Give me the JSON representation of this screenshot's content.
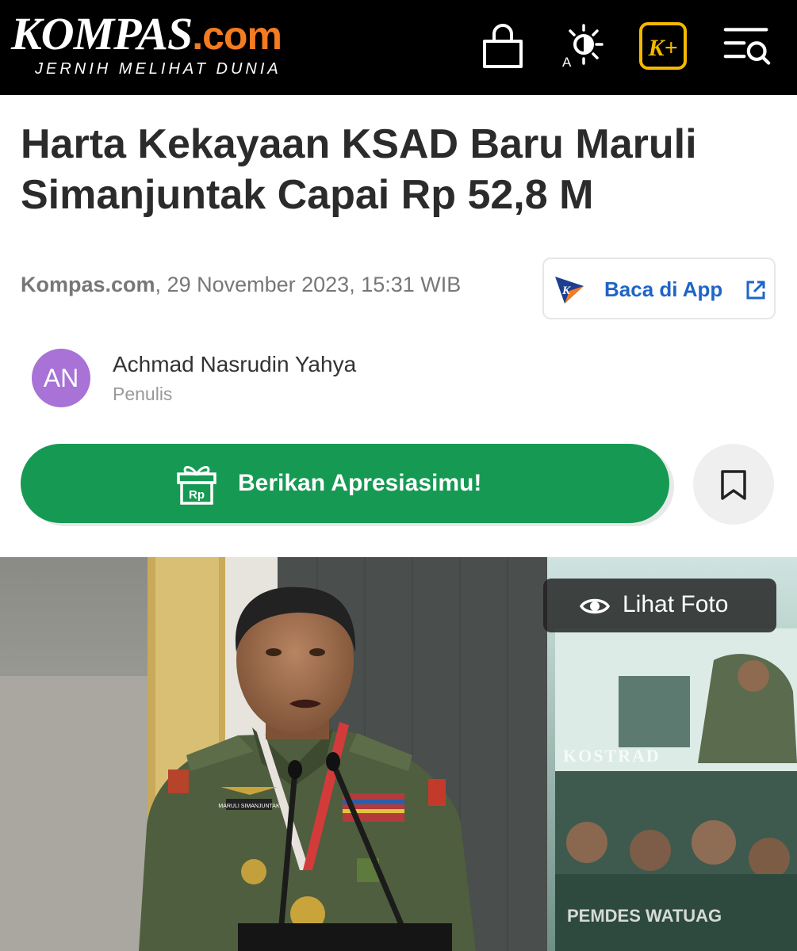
{
  "header": {
    "logo_main": "KOMPAS",
    "logo_dotcom": ".com",
    "logo_tagline": "JERNIH MELIHAT DUNIA",
    "icons": [
      "shopping-bag-icon",
      "theme-brightness-icon",
      "kompas-plus-icon",
      "menu-search-icon"
    ],
    "brightness_letter": "A",
    "kplus_label": "K+",
    "accent_color": "#f47b20",
    "kplus_color": "#f5b800"
  },
  "article": {
    "title": "Harta Kekayaan KSAD Baru Maruli Simanjuntak Capai Rp 52,8 M",
    "source": "Kompas.com",
    "date": ", 29 November 2023, 15:31 WIB",
    "read_in_app_label": "Baca di App",
    "read_in_app_logo": "K",
    "author_initials": "AN",
    "author_name": "Achmad Nasrudin Yahya",
    "author_role": "Penulis",
    "appreciation_label": "Berikan Apresiasimu!",
    "appreciation_icon_text": "Rp",
    "appreciation_color": "#169a53",
    "link_color": "#1f64c8"
  },
  "photo": {
    "view_photo_label": "Lihat Foto",
    "name_tag": "MARULI SIMANJUNTAK",
    "screen_text_1": "KOSTRAD",
    "screen_text_2": "PEMDES WATUAG"
  }
}
